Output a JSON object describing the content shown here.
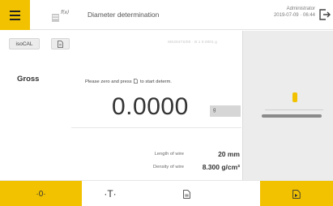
{
  "header": {
    "title": "Diameter determination",
    "user": "Administrator",
    "datetime": "2019-07-09 · 06:44",
    "menu_icon": "hamburger-icon",
    "method_icon": "method-icon",
    "logout_icon": "logout-icon"
  },
  "toolbar": {
    "iso_cal_label": "isoCAL",
    "doc_icon": "document-icon",
    "info_text": "MS204TS/00 · B 1 0.0001 g"
  },
  "main": {
    "mode_label": "Gross",
    "instruction_before": "Please zero and press",
    "instruction_after": "to start determ.",
    "instruction_icon": "start-document-icon",
    "weight_value": "0.0000",
    "unit": "g"
  },
  "params": [
    {
      "label": "Length of wire",
      "value": "20 mm"
    },
    {
      "label": "Density of wire",
      "value": "8.300 g/cm³"
    }
  ],
  "footer": {
    "zero_label": "·0·",
    "tare_label": "·T·",
    "print_icon": "print-icon",
    "result_icon": "result-icon"
  },
  "colors": {
    "accent": "#f2c200",
    "panel": "#ececec",
    "text": "#333333"
  }
}
